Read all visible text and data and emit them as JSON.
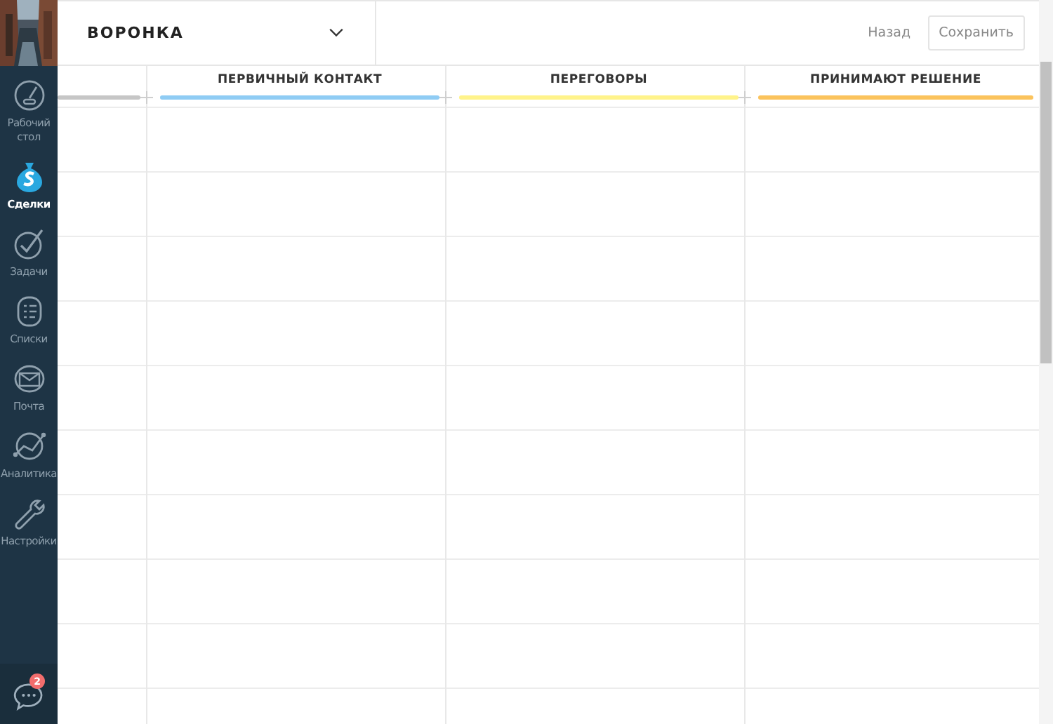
{
  "sidebar": {
    "items": [
      {
        "kind": "dashboard",
        "label": "Рабочий стол",
        "selected": false
      },
      {
        "kind": "deals",
        "label": "Сделки",
        "selected": true
      },
      {
        "kind": "tasks",
        "label": "Задачи",
        "selected": false
      },
      {
        "kind": "lists",
        "label": "Списки",
        "selected": false
      },
      {
        "kind": "mail",
        "label": "Почта",
        "selected": false
      },
      {
        "kind": "analytics",
        "label": "Аналитика",
        "selected": false
      },
      {
        "kind": "settings",
        "label": "Настройки",
        "selected": false
      }
    ],
    "chat": {
      "badge": "2"
    }
  },
  "header": {
    "title": "ВОРОНКА",
    "back": "Назад",
    "save": "Сохранить"
  },
  "stages": [
    {
      "color": "#c6c6c6"
    },
    {
      "title": "ПЕРВИЧНЫЙ КОНТАКТ",
      "color": "#8fccf4"
    },
    {
      "title": "ПЕРЕГОВОРЫ",
      "color": "#fff38a"
    },
    {
      "title": "ПРИНИМАЮТ РЕШЕНИЕ",
      "color": "#fbc35c"
    }
  ]
}
